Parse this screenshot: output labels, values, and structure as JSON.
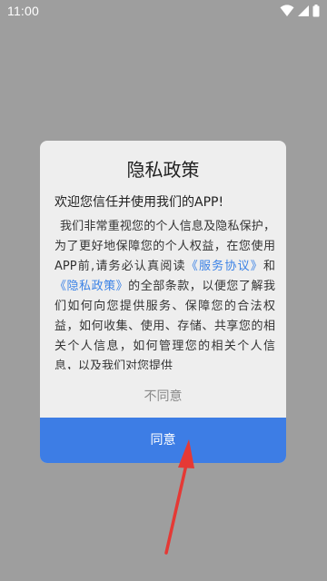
{
  "status_bar": {
    "time": "11:00",
    "icons": [
      "wifi-icon",
      "signal-icon",
      "battery-icon"
    ]
  },
  "dialog": {
    "title": "隐私政策",
    "greeting": "欢迎您信任并使用我们的APP!",
    "body": {
      "intro": "我们非常重视您的个人信息及隐私保护，为了更好地保障您的个人权益，在您使用APP前,请务必认真阅读",
      "link_service": "《服务协议》",
      "and_text": "和",
      "link_privacy": "《隐私政策》",
      "rest": "的全部条款，以便您了解我们如何向您提供服务、保障您的合法权益，如何收集、使用、存储、共享您的相关个人信息，如何管理您的相关个人信息，以及我们对您提供"
    },
    "disagree_label": "不同意",
    "agree_label": "同意"
  },
  "colors": {
    "backdrop": "#9e9e9e",
    "dialog_bg": "#eeeeee",
    "accent": "#3d7de5",
    "link": "#3b82e6",
    "annotation_arrow": "#e53935"
  }
}
